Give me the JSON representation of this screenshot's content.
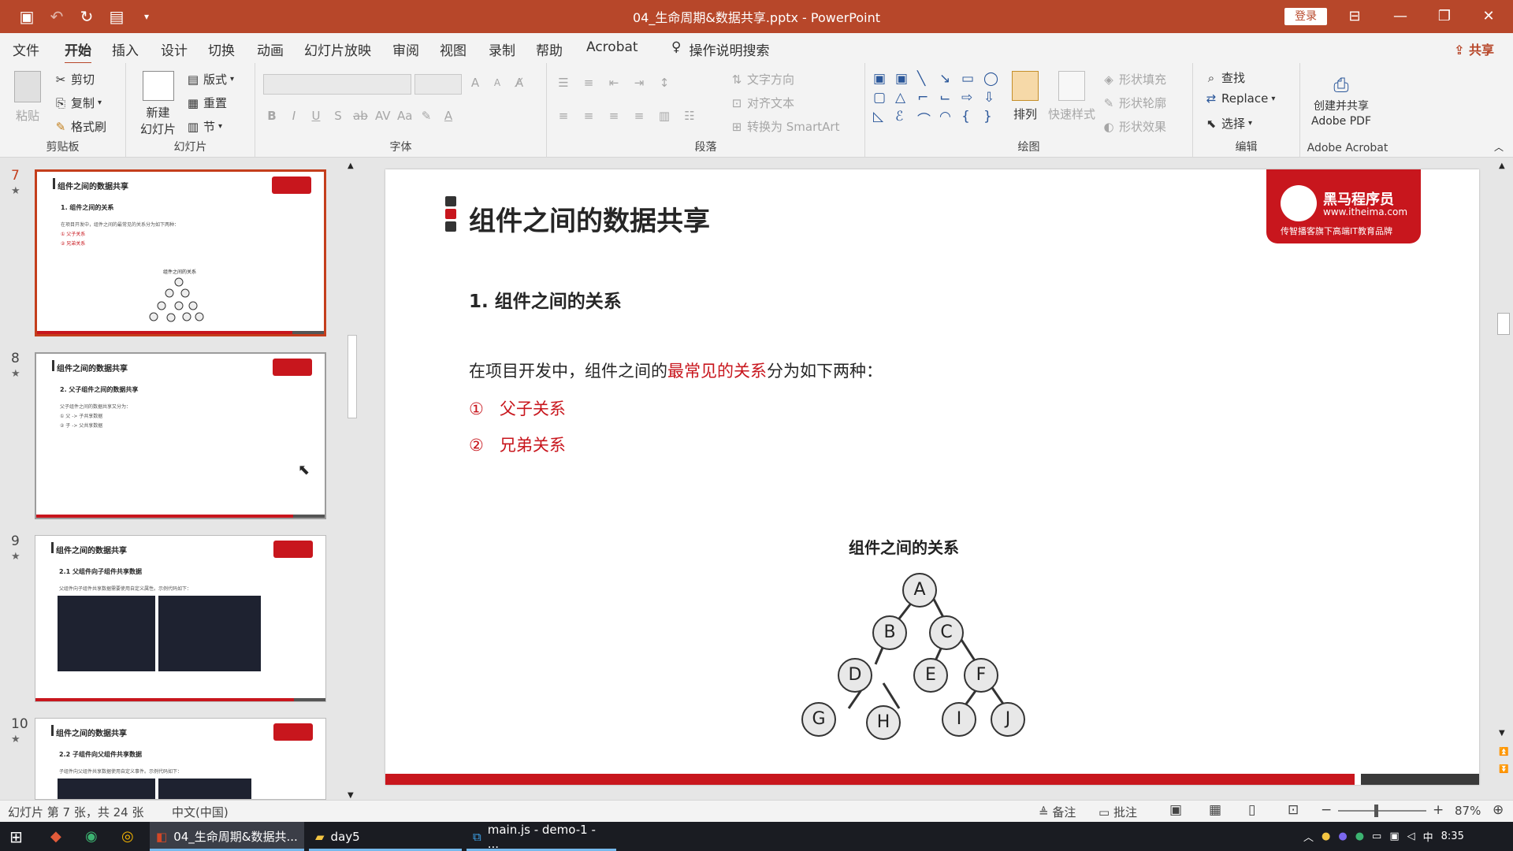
{
  "titlebar": {
    "title": "04_生命周期&数据共享.pptx  -  PowerPoint",
    "login": "登录",
    "qa_icons": [
      "save-icon",
      "undo-icon",
      "redo-icon",
      "present-icon",
      "customize-icon"
    ]
  },
  "menu": {
    "tabs": [
      "文件",
      "开始",
      "插入",
      "设计",
      "切换",
      "动画",
      "幻灯片放映",
      "审阅",
      "视图",
      "录制",
      "帮助",
      "Acrobat"
    ],
    "active": "开始",
    "search": "操作说明搜索",
    "share": "共享"
  },
  "ribbon": {
    "clipboard": {
      "label": "剪贴板",
      "paste": "粘贴",
      "cut": "剪切",
      "copy": "复制",
      "format_painter": "格式刷"
    },
    "slides": {
      "label": "幻灯片",
      "new_slide_1": "新建",
      "new_slide_2": "幻灯片",
      "layout": "版式",
      "reset": "重置",
      "section": "节"
    },
    "font": {
      "label": "字体"
    },
    "paragraph": {
      "label": "段落",
      "text_direction": "文字方向",
      "align_text": "对齐文本",
      "smartart": "转换为 SmartArt"
    },
    "drawing": {
      "label": "绘图",
      "arrange": "排列",
      "quick_styles": "快速样式",
      "shape_fill": "形状填充",
      "shape_outline": "形状轮廓",
      "shape_effects": "形状效果"
    },
    "editing": {
      "label": "编辑",
      "find": "查找",
      "replace": "Replace",
      "select": "选择"
    },
    "acrobat": {
      "label": "Adobe Acrobat",
      "create_1": "创建并共享",
      "create_2": "Adobe PDF"
    }
  },
  "thumbnails": [
    {
      "num": "7",
      "title": "组件之间的数据共享",
      "sub": "1. 组件之间的关系",
      "line1": "在项目开发中，组件之间的最常见的关系分为如下两种：",
      "line2": "① 父子关系",
      "line3": "② 兄弟关系",
      "diagram": "组件之间的关系"
    },
    {
      "num": "8",
      "title": "组件之间的数据共享",
      "sub": "2. 父子组件之间的数据共享",
      "line1": "父子组件之间的数据共享又分为：",
      "line2": "① 父 -> 子共享数据",
      "line3": "② 子 -> 父共享数据"
    },
    {
      "num": "9",
      "title": "组件之间的数据共享",
      "sub": "2.1 父组件向子组件共享数据",
      "line1": "父组件向子组件共享数据需要使用自定义属性。示例代码如下："
    },
    {
      "num": "10",
      "title": "组件之间的数据共享",
      "sub": "2.2 子组件向父组件共享数据",
      "line1": "子组件向父组件共享数据使用自定义事件。示例代码如下："
    }
  ],
  "slide": {
    "title": "组件之间的数据共享",
    "logo": {
      "name": "黑马程序员",
      "url": "www.itheima.com",
      "tagline": "传智播客旗下高端IT教育品牌"
    },
    "heading": "1. 组件之间的关系",
    "para_before": "在项目开发中，组件之间的",
    "para_highlight": "最常见的关系",
    "para_after": "分为如下两种：",
    "items": [
      {
        "num": "①",
        "text": "父子关系"
      },
      {
        "num": "②",
        "text": "兄弟关系"
      }
    ],
    "diagram_title": "组件之间的关系",
    "nodes": [
      "A",
      "B",
      "C",
      "D",
      "E",
      "F",
      "G",
      "H",
      "I",
      "J"
    ]
  },
  "status": {
    "slide_info": "幻灯片 第 7 张，共 24 张",
    "language": "中文(中国)",
    "notes": "备注",
    "comments": "批注",
    "zoom": "87%"
  },
  "taskbar": {
    "items": [
      "04_生命周期&数据共...",
      "day5",
      "main.js - demo-1 - ..."
    ],
    "ime": "中",
    "time": "8:35"
  },
  "colors": {
    "accent": "#b7472a",
    "brand_red": "#c8161d"
  }
}
